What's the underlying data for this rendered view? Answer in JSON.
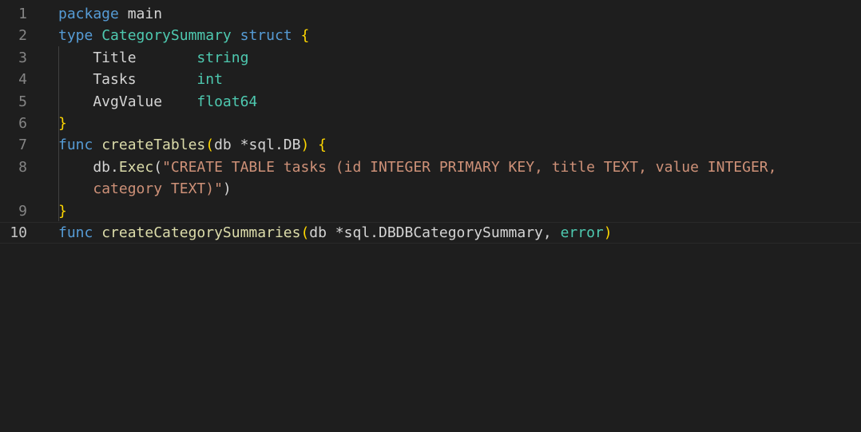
{
  "editor": {
    "language": "go",
    "lines": [
      {
        "num": "1",
        "tokens": [
          {
            "t": "package",
            "c": "kw"
          },
          {
            "t": " main",
            "c": "plain"
          }
        ]
      },
      {
        "num": "2",
        "tokens": [
          {
            "t": "type",
            "c": "kw"
          },
          {
            "t": " ",
            "c": "plain"
          },
          {
            "t": "CategorySummary",
            "c": "type"
          },
          {
            "t": " ",
            "c": "plain"
          },
          {
            "t": "struct",
            "c": "kw"
          },
          {
            "t": " ",
            "c": "plain"
          },
          {
            "t": "{",
            "c": "brace"
          }
        ]
      },
      {
        "num": "3",
        "tokens": [
          {
            "t": "    Title       ",
            "c": "plain"
          },
          {
            "t": "string",
            "c": "type"
          }
        ]
      },
      {
        "num": "4",
        "tokens": [
          {
            "t": "    Tasks       ",
            "c": "plain"
          },
          {
            "t": "int",
            "c": "type"
          }
        ]
      },
      {
        "num": "5",
        "tokens": [
          {
            "t": "    AvgValue    ",
            "c": "plain"
          },
          {
            "t": "float64",
            "c": "type"
          }
        ]
      },
      {
        "num": "6",
        "tokens": [
          {
            "t": "}",
            "c": "brace"
          }
        ]
      },
      {
        "num": "7",
        "tokens": [
          {
            "t": "func",
            "c": "kw"
          },
          {
            "t": " ",
            "c": "plain"
          },
          {
            "t": "createTables",
            "c": "fn"
          },
          {
            "t": "(",
            "c": "brace"
          },
          {
            "t": "db *sql.DB",
            "c": "plain"
          },
          {
            "t": ")",
            "c": "brace"
          },
          {
            "t": " ",
            "c": "plain"
          },
          {
            "t": "{",
            "c": "brace"
          }
        ]
      },
      {
        "num": "8",
        "tokens": [
          {
            "t": "    db.",
            "c": "plain"
          },
          {
            "t": "Exec",
            "c": "fn"
          },
          {
            "t": "(",
            "c": "plain"
          },
          {
            "t": "\"CREATE TABLE tasks (id INTEGER PRIMARY KEY, title TEXT, value INTEGER,",
            "c": "str"
          }
        ]
      },
      {
        "num": "",
        "tokens": [
          {
            "t": "    ",
            "c": "plain"
          },
          {
            "t": "category TEXT)\"",
            "c": "str"
          },
          {
            "t": ")",
            "c": "plain"
          }
        ]
      },
      {
        "num": "9",
        "tokens": [
          {
            "t": "}",
            "c": "brace"
          }
        ]
      },
      {
        "num": "10",
        "active": true,
        "tokens": [
          {
            "t": "func",
            "c": "kw"
          },
          {
            "t": " ",
            "c": "plain"
          },
          {
            "t": "createCategorySummaries",
            "c": "fn"
          },
          {
            "t": "(",
            "c": "brace"
          },
          {
            "t": "db *sql.DBDBCategorySummary, ",
            "c": "plain"
          },
          {
            "t": "error",
            "c": "type"
          },
          {
            "t": ")",
            "c": "brace"
          }
        ]
      }
    ]
  },
  "colors": {
    "background": "#1e1e1e",
    "keyword": "#569cd6",
    "type": "#4ec9b0",
    "function": "#dcdcaa",
    "string": "#ce9178",
    "bracket": "#ffd700",
    "line_number": "#858585"
  }
}
